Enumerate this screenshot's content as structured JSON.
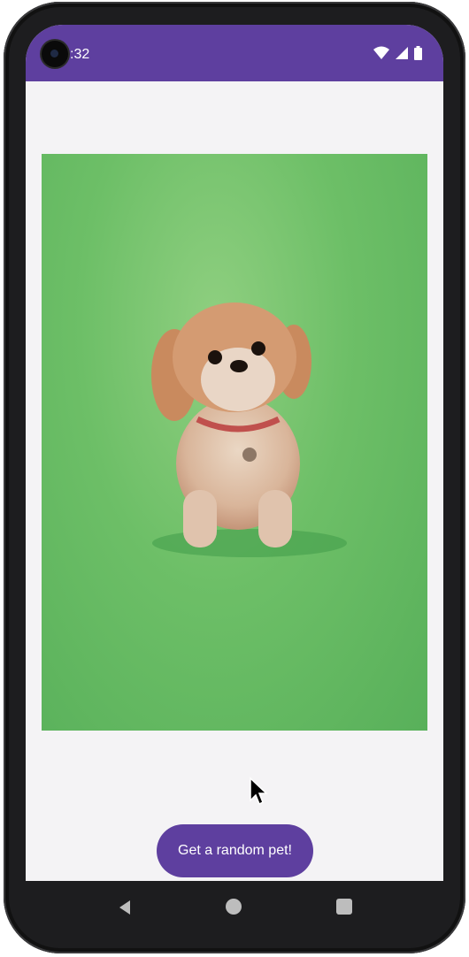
{
  "status_bar": {
    "time": ":32",
    "background_color": "#5e3f9f",
    "icons": [
      "camera-icon",
      "wifi-icon",
      "signal-icon",
      "battery-icon"
    ]
  },
  "main": {
    "image_subject": "small-fluffy-dog-on-green-backdrop",
    "image_background_color": "#6dbf67",
    "button_label": "Get a random pet!",
    "button_color": "#5e3f9f"
  },
  "nav_bar": {
    "icons": [
      "back-icon",
      "home-icon",
      "recents-icon"
    ]
  }
}
